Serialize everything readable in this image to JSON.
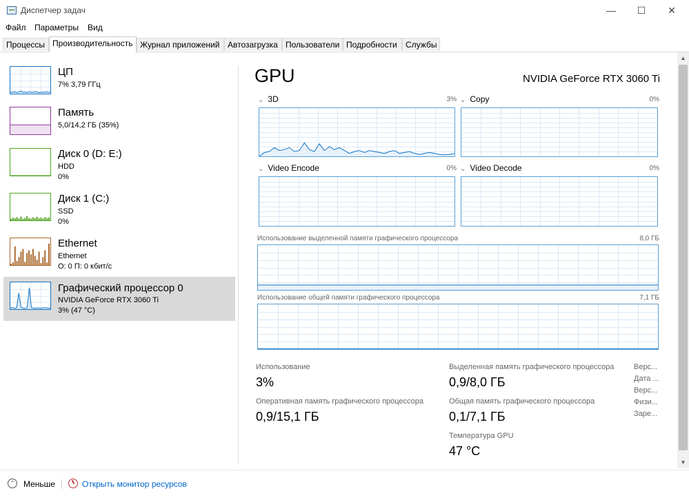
{
  "window": {
    "title": "Диспетчер задач"
  },
  "menu": [
    "Файл",
    "Параметры",
    "Вид"
  ],
  "tabs": [
    "Процессы",
    "Производительность",
    "Журнал приложений",
    "Автозагрузка",
    "Пользователи",
    "Подробности",
    "Службы"
  ],
  "active_tab": "Производительность",
  "sidebar": {
    "items": [
      {
        "name": "ЦП",
        "sub1": "7% 3,79 ГГц",
        "sub2": "",
        "color": "#1173c3"
      },
      {
        "name": "Память",
        "sub1": "5,0/14,2 ГБ (35%)",
        "sub2": "",
        "color": "#8b3a9b"
      },
      {
        "name": "Диск 0 (D: E:)",
        "sub1": "HDD",
        "sub2": "0%",
        "color": "#4da31e"
      },
      {
        "name": "Диск 1 (C:)",
        "sub1": "SSD",
        "sub2": "0%",
        "color": "#4da31e"
      },
      {
        "name": "Ethernet",
        "sub1": "Ethernet",
        "sub2": "О: 0 П: 0 кбит/с",
        "color": "#a76323"
      },
      {
        "name": "Графический процессор 0",
        "sub1": "NVIDIA GeForce RTX 3060 Ti",
        "sub2": "3% (47 °C)",
        "color": "#1173c3"
      }
    ]
  },
  "gpu": {
    "title": "GPU",
    "model": "NVIDIA GeForce RTX 3060 Ti",
    "engines": [
      {
        "name": "3D",
        "pct": "3%"
      },
      {
        "name": "Copy",
        "pct": "0%"
      },
      {
        "name": "Video Encode",
        "pct": "0%"
      },
      {
        "name": "Video Decode",
        "pct": "0%"
      }
    ],
    "dedicated_label": "Использование выделенной памяти графического процессора",
    "dedicated_max": "8,0 ГБ",
    "shared_label": "Использование общей памяти графического процессора",
    "shared_max": "7,1 ГБ"
  },
  "stats": {
    "usage_label": "Использование",
    "usage_value": "3%",
    "dedicated_label": "Выделенная память графического процессора",
    "dedicated_value": "0,9/8,0 ГБ",
    "ram_label": "Оперативная память графического процессора",
    "ram_value": "0,9/15,1 ГБ",
    "shared_label": "Общая память графического процессора",
    "shared_value": "0,1/7,1 ГБ",
    "temp_label": "Температура GPU",
    "temp_value": "47 °C"
  },
  "info": [
    "Верс...",
    "Дата ...",
    "Верс...",
    "Физи...",
    "Заре..."
  ],
  "footer": {
    "less": "Меньше",
    "monitor": "Открыть монитор ресурсов"
  },
  "colors": {
    "accent_gpu": "#1173c3",
    "grid": "#d9e8f5",
    "graph_border": "#5aa0d6",
    "selected_bg": "#d9d9d9"
  },
  "graph_series": {
    "sidebar_cpu": [
      5,
      5,
      8,
      4,
      6,
      10,
      5,
      6,
      4,
      7,
      5,
      6,
      8,
      5,
      4,
      6,
      5,
      7,
      5,
      6
    ],
    "sidebar_memory": [
      35,
      35,
      35,
      35,
      35,
      35,
      35,
      35,
      35,
      35,
      35,
      35,
      35,
      35,
      35,
      35,
      35,
      35,
      35,
      35
    ],
    "sidebar_disk0": [
      0,
      0,
      0,
      0,
      0,
      0,
      0,
      0,
      0,
      0,
      0,
      0,
      0,
      0,
      0,
      0,
      0,
      0,
      0,
      0
    ],
    "sidebar_disk1": [
      6,
      10,
      8,
      12,
      7,
      14,
      6,
      9,
      15,
      8,
      7,
      11,
      9,
      13,
      8,
      10,
      7,
      12,
      9,
      11
    ],
    "sidebar_ethernet": [
      5,
      10,
      70,
      15,
      30,
      50,
      60,
      12,
      45,
      55,
      40,
      60,
      35,
      20,
      50,
      8,
      30,
      55,
      10,
      80
    ],
    "sidebar_gpu": [
      4,
      6,
      3,
      5,
      60,
      8,
      4,
      3,
      5,
      80,
      6,
      4,
      3,
      5,
      4,
      3,
      6,
      5,
      4,
      3
    ],
    "gpu_3d": [
      0,
      8,
      10,
      18,
      12,
      14,
      18,
      10,
      12,
      28,
      14,
      10,
      26,
      12,
      20,
      14,
      18,
      12,
      6,
      10,
      12,
      8,
      12,
      10,
      8,
      6,
      10,
      12,
      6,
      8,
      10,
      6,
      4,
      6,
      8,
      6,
      4,
      3,
      4,
      6
    ],
    "gpu_dedicated": [
      11,
      11,
      11,
      11,
      11,
      11,
      11,
      11,
      11,
      11,
      11,
      11,
      11,
      11,
      11,
      11,
      11,
      11,
      11,
      11
    ],
    "gpu_shared": [
      1,
      1,
      1,
      1,
      1,
      1,
      1,
      1,
      1,
      1,
      1,
      1,
      1,
      1,
      1,
      1,
      1,
      1,
      1,
      1
    ]
  }
}
